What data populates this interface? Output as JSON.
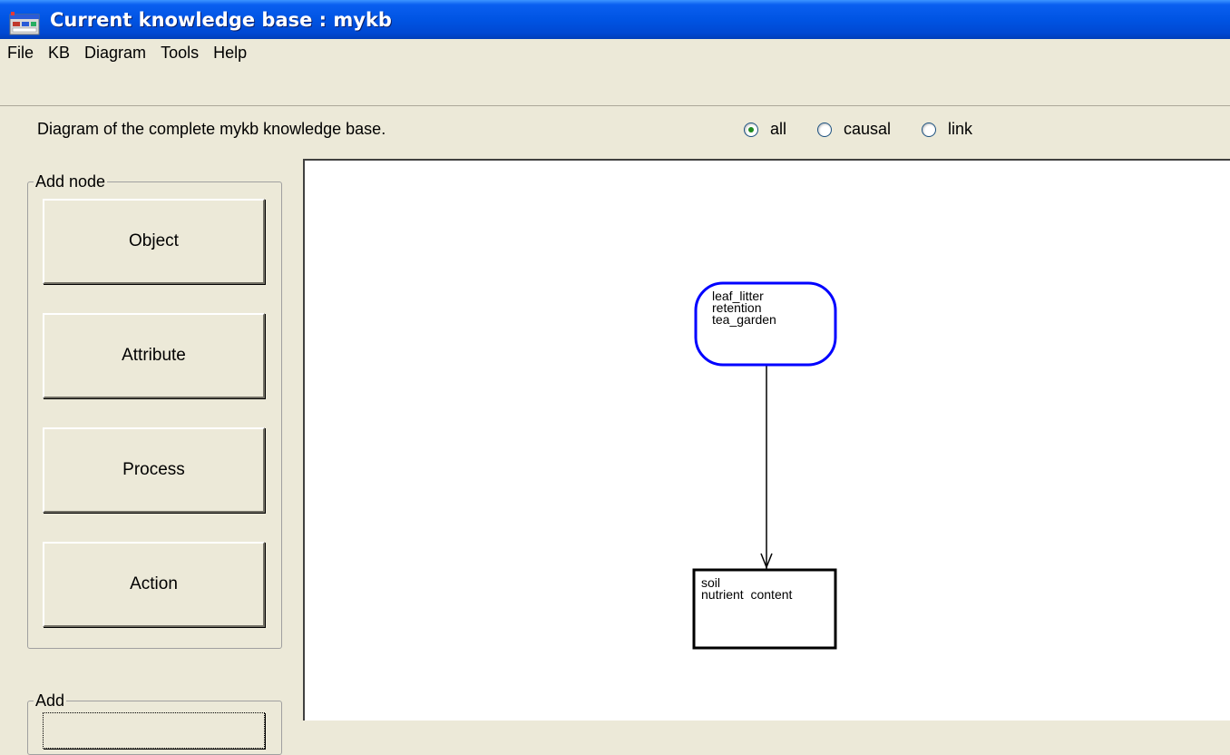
{
  "window": {
    "title": "Current knowledge base : mykb",
    "icon": "app-icon"
  },
  "menubar": {
    "items": [
      "File",
      "KB",
      "Diagram",
      "Tools",
      "Help"
    ]
  },
  "toolbar": {
    "description": "Diagram of the complete mykb knowledge base.",
    "filter_options": [
      {
        "label": "all",
        "selected": true
      },
      {
        "label": "causal",
        "selected": false
      },
      {
        "label": "link",
        "selected": false
      }
    ]
  },
  "left_panel": {
    "add_node": {
      "label": "Add node",
      "buttons": [
        "Object",
        "Attribute",
        "Process",
        "Action"
      ]
    },
    "add_group": {
      "label": "Add"
    }
  },
  "diagram": {
    "nodes": [
      {
        "shape": "rounded",
        "color": "#0000ff",
        "lines": [
          "leaf_litter",
          "retention",
          "tea_garden"
        ]
      },
      {
        "shape": "rectangle",
        "color": "#000000",
        "lines": [
          "soil",
          "nutrient_content"
        ]
      }
    ],
    "edges": [
      {
        "from": 0,
        "to": 1
      }
    ]
  }
}
